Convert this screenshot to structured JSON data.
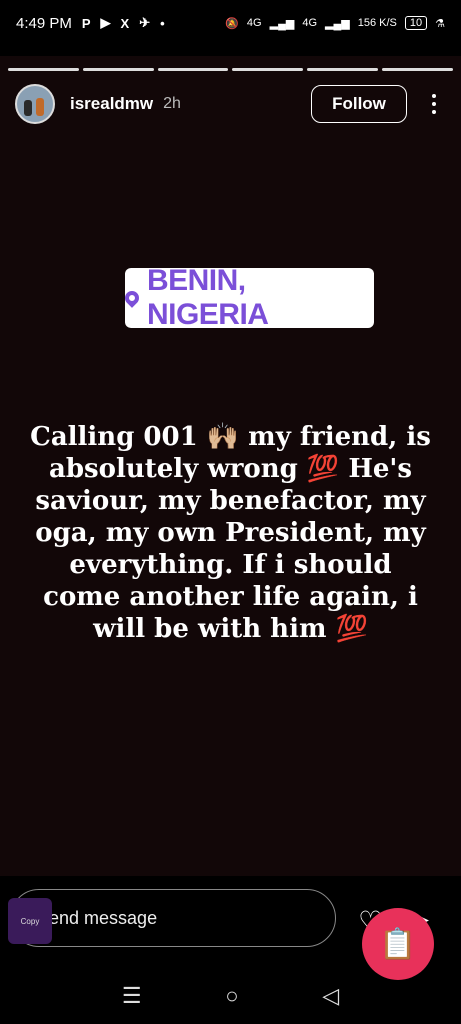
{
  "status": {
    "time": "4:49 PM",
    "left_icons": [
      "P",
      "▶",
      "X",
      "✈",
      "•"
    ],
    "net1": "4G",
    "net2": "4G",
    "speed": "156 K/S",
    "battery": "10"
  },
  "story": {
    "username": "isrealdmw",
    "time_ago": "2h",
    "follow_label": "Follow",
    "location": "BENIN, NIGERIA",
    "caption": "Calling 001 🙌🏼 my friend, is absolutely wrong 💯 He's saviour, my benefactor, my oga, my own President, my everything. If i should come another life again, i will be with him 💯",
    "progress_segments": 6
  },
  "bottom": {
    "message_placeholder": "Send message",
    "copy_label": "Copy"
  },
  "colors": {
    "location_text": "#7b4fd8",
    "fab": "#e8315a",
    "background": "#120708"
  }
}
